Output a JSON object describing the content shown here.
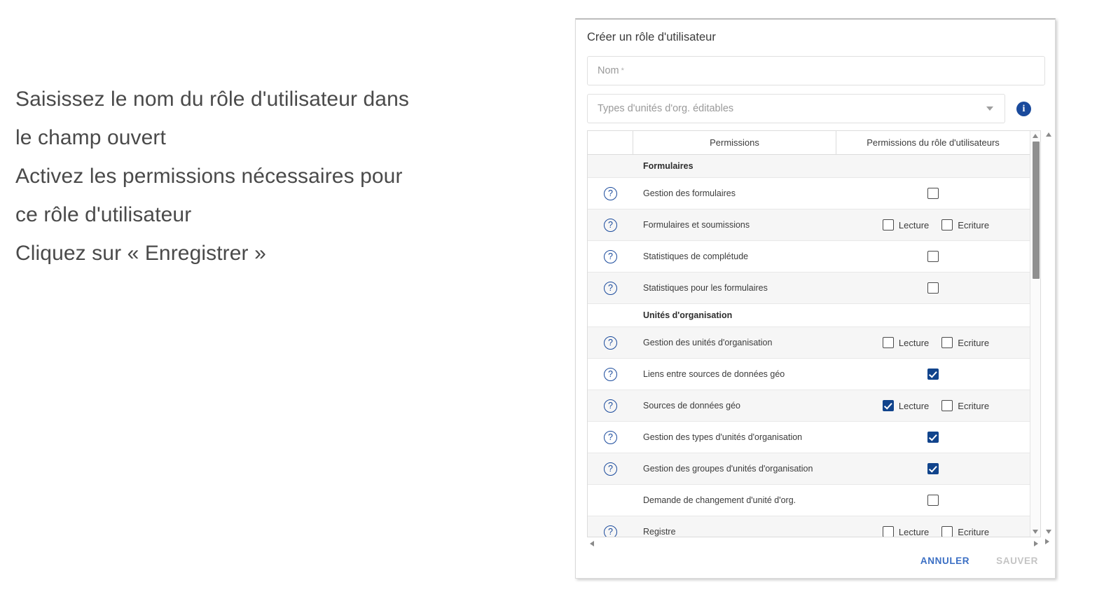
{
  "instructions": {
    "lines": [
      "Saisissez le nom du rôle d'utilisateur dans",
      "le champ ouvert",
      "Activez les permissions nécessaires pour",
      "ce rôle d'utilisateur",
      "Cliquez sur « Enregistrer »"
    ]
  },
  "panel": {
    "title": "Créer un rôle d'utilisateur",
    "name_field": {
      "placeholder": "Nom",
      "required_mark": "*",
      "value": ""
    },
    "orgtype_field": {
      "placeholder": "Types d'unités d'org. éditables",
      "value": ""
    },
    "info_icon_glyph": "i",
    "table": {
      "headers": [
        "",
        "Permissions",
        "Permissions du rôle d'utilisateurs"
      ],
      "rows": [
        {
          "kind": "section",
          "label": "Formulaires",
          "help": false,
          "control": "none"
        },
        {
          "kind": "item",
          "label": "Gestion des formulaires",
          "help": true,
          "control": "single",
          "checked": false
        },
        {
          "kind": "item",
          "label": "Formulaires et soumissions",
          "help": true,
          "control": "dual",
          "read_label": "Lecture",
          "write_label": "Ecriture",
          "read_checked": false,
          "write_checked": false
        },
        {
          "kind": "item",
          "label": "Statistiques de complétude",
          "help": true,
          "control": "single",
          "checked": false
        },
        {
          "kind": "item",
          "label": "Statistiques pour les formulaires",
          "help": true,
          "control": "single",
          "checked": false
        },
        {
          "kind": "section",
          "label": "Unités d'organisation",
          "help": false,
          "control": "none"
        },
        {
          "kind": "item",
          "label": "Gestion des unités d'organisation",
          "help": true,
          "control": "dual",
          "read_label": "Lecture",
          "write_label": "Ecriture",
          "read_checked": false,
          "write_checked": false
        },
        {
          "kind": "item",
          "label": "Liens entre sources de données géo",
          "help": true,
          "control": "single",
          "checked": true
        },
        {
          "kind": "item",
          "label": "Sources de données géo",
          "help": true,
          "control": "dual",
          "read_label": "Lecture",
          "write_label": "Ecriture",
          "read_checked": true,
          "write_checked": false
        },
        {
          "kind": "item",
          "label": "Gestion des types d'unités d'organisation",
          "help": true,
          "control": "single",
          "checked": true
        },
        {
          "kind": "item",
          "label": "Gestion des groupes d'unités d'organisation",
          "help": true,
          "control": "single",
          "checked": true
        },
        {
          "kind": "item",
          "label": "Demande de changement d'unité d'org.",
          "help": false,
          "control": "single",
          "checked": false
        },
        {
          "kind": "item",
          "label": "Registre",
          "help": true,
          "control": "dual",
          "read_label": "Lecture",
          "write_label": "Ecriture",
          "read_checked": false,
          "write_checked": false
        }
      ]
    },
    "footer": {
      "cancel_label": "ANNULER",
      "save_label": "SAUVER"
    }
  },
  "colors": {
    "accent_blue": "#1a4a9c",
    "checkbox_checked": "#11448c",
    "cancel_link": "#3b6fc4",
    "save_disabled": "#c4c4c4",
    "row_alt": "#f6f6f6",
    "text": "#3c3c3c"
  }
}
